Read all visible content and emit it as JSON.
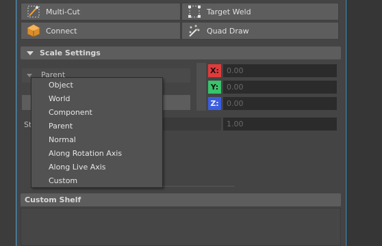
{
  "toolbar": {
    "multi_cut": "Multi-Cut",
    "target_weld": "Target Weld",
    "connect": "Connect",
    "quad_draw": "Quad Draw"
  },
  "scale_settings": {
    "title": "Scale Settings",
    "dropdown_value": "Parent",
    "x_label": "X:",
    "y_label": "Y:",
    "z_label": "Z:",
    "x_value": "0.00",
    "y_value": "0.00",
    "z_value": "0.00",
    "step_label": "St",
    "step_value": "1.00"
  },
  "menu": {
    "items": [
      "Object",
      "World",
      "Component",
      "Parent",
      "Normal",
      "Along Rotation Axis",
      "Along Live Axis",
      "Custom"
    ]
  },
  "custom_shelf": {
    "title": "Custom Shelf"
  },
  "colors": {
    "x_axis": "#e03b3b",
    "y_axis": "#38c46b",
    "z_axis": "#3a5ee0",
    "accent_line": "#3a9ad9"
  }
}
